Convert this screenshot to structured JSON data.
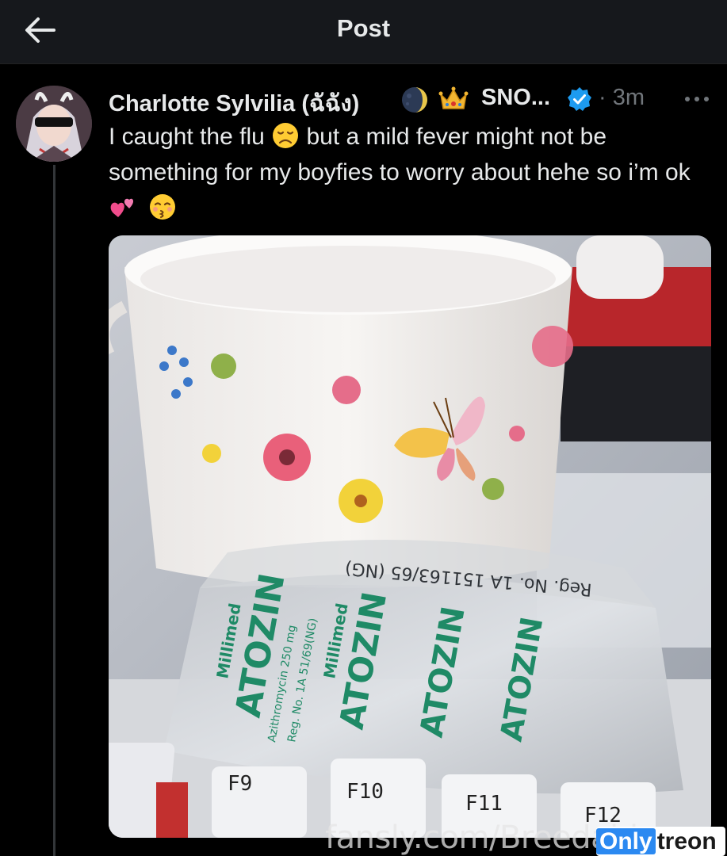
{
  "header": {
    "title": "Post",
    "back_icon": "arrow-left-icon"
  },
  "post": {
    "author": {
      "display_name": "Charlotte Sylvilia (ฉัฉัง)",
      "name_emojis": [
        "moon-icon",
        "crown-icon"
      ],
      "name_suffix": "SNO...",
      "verified": true
    },
    "time": "· 3m",
    "text_parts": [
      "I caught the flu ",
      " but a mild fever might not be something for my boyfies to worry about hehe so i’m ok "
    ],
    "text_emojis": [
      "disappointed-face-icon",
      "two-hearts-icon",
      "kissing-face-icon"
    ]
  },
  "media": {
    "package_texts": [
      "Millimed",
      "ATOZIN",
      "Azithromycin 250 mg",
      "Reg. No. 1A 51/69(NG)",
      "Reg. No. 1A 151163/65 (NG)"
    ],
    "keyboard_keys": [
      "F9",
      "F10",
      "F11",
      "F12"
    ]
  },
  "watermark": {
    "site": "fansly.com/Breedable",
    "brand_a": "Only",
    "brand_b": "treon"
  },
  "colors": {
    "background": "#000000",
    "header": "#16181c",
    "text": "#e7e9ea",
    "muted": "#71767b",
    "verified": "#1d9bf0"
  }
}
